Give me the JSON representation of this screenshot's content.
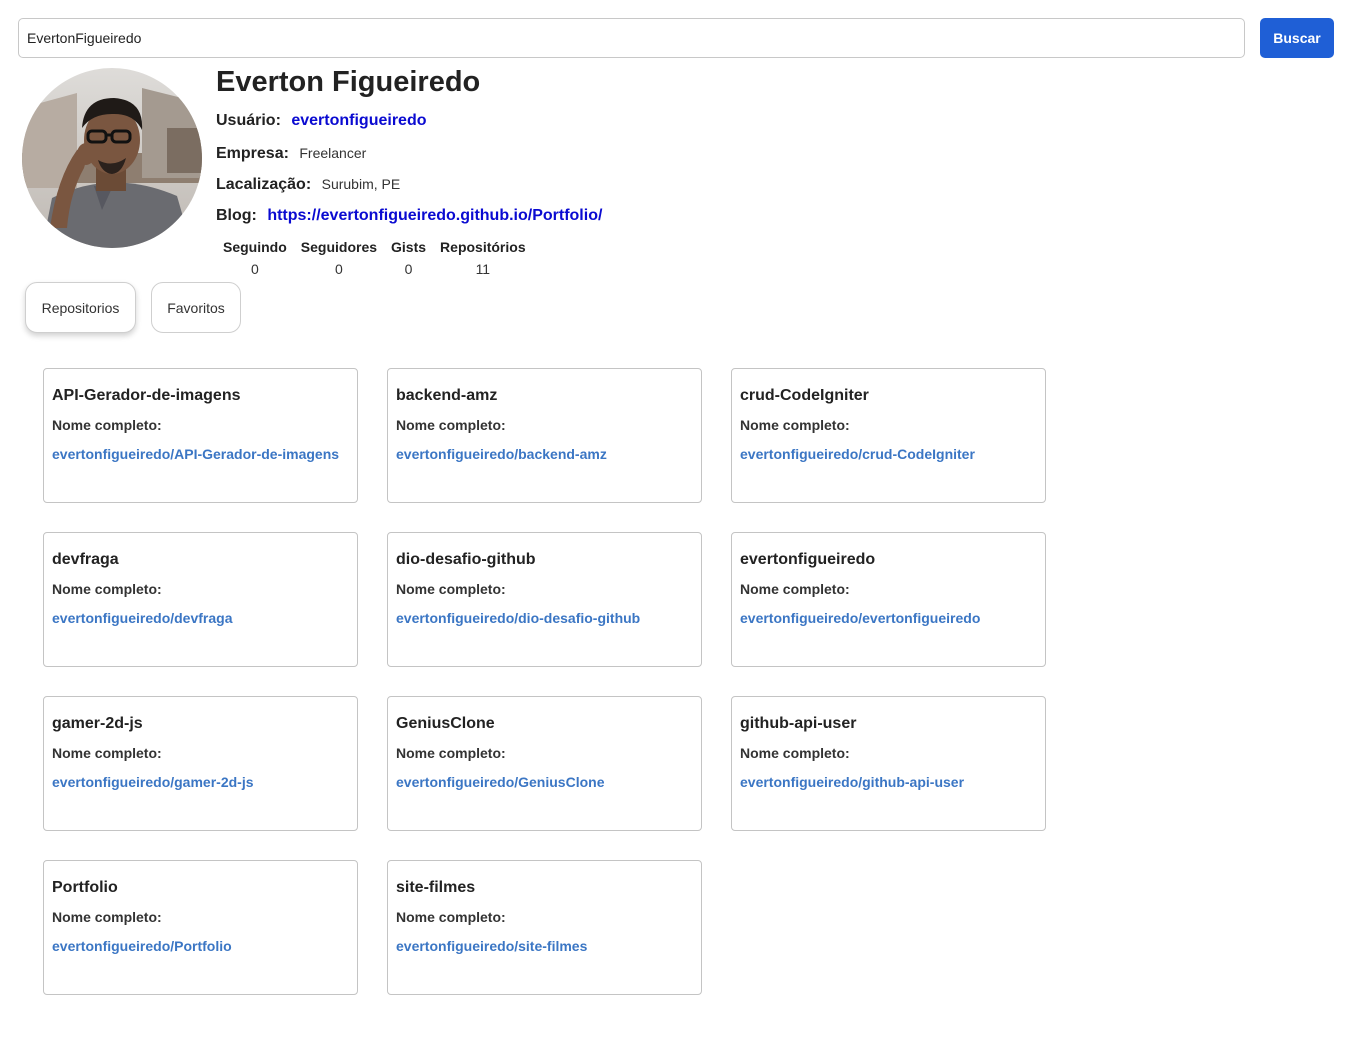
{
  "search": {
    "value": "EvertonFigueiredo",
    "button_label": "Buscar"
  },
  "profile": {
    "name": "Everton Figueiredo",
    "usuario_label": "Usuário:",
    "usuario_value": "evertonfigueiredo",
    "empresa_label": "Empresa:",
    "empresa_value": "Freelancer",
    "localizacao_label": "Lacalização:",
    "localizacao_value": "Surubim, PE",
    "blog_label": "Blog:",
    "blog_value": "https://evertonfigueiredo.github.io/Portfolio/"
  },
  "stats": [
    {
      "label": "Seguindo",
      "value": "0"
    },
    {
      "label": "Seguidores",
      "value": "0"
    },
    {
      "label": "Gists",
      "value": "0"
    },
    {
      "label": "Repositórios",
      "value": "11"
    }
  ],
  "tabs": {
    "repositorios": "Repositorios",
    "favoritos": "Favoritos"
  },
  "repo_fullname_label": "Nome completo:",
  "repos": [
    {
      "name": "API-Gerador-de-imagens",
      "full_name": "evertonfigueiredo/API-Gerador-de-imagens"
    },
    {
      "name": "backend-amz",
      "full_name": "evertonfigueiredo/backend-amz"
    },
    {
      "name": "crud-CodeIgniter",
      "full_name": "evertonfigueiredo/crud-CodeIgniter"
    },
    {
      "name": "devfraga",
      "full_name": "evertonfigueiredo/devfraga"
    },
    {
      "name": "dio-desafio-github",
      "full_name": "evertonfigueiredo/dio-desafio-github"
    },
    {
      "name": "evertonfigueiredo",
      "full_name": "evertonfigueiredo/evertonfigueiredo"
    },
    {
      "name": "gamer-2d-js",
      "full_name": "evertonfigueiredo/gamer-2d-js"
    },
    {
      "name": "GeniusClone",
      "full_name": "evertonfigueiredo/GeniusClone"
    },
    {
      "name": "github-api-user",
      "full_name": "evertonfigueiredo/github-api-user"
    },
    {
      "name": "Portfolio",
      "full_name": "evertonfigueiredo/Portfolio"
    },
    {
      "name": "site-filmes",
      "full_name": "evertonfigueiredo/site-filmes"
    }
  ],
  "colors": {
    "accent": "#1f5fd6",
    "link": "#0a0ad1",
    "repo_link": "#3b76c4"
  }
}
